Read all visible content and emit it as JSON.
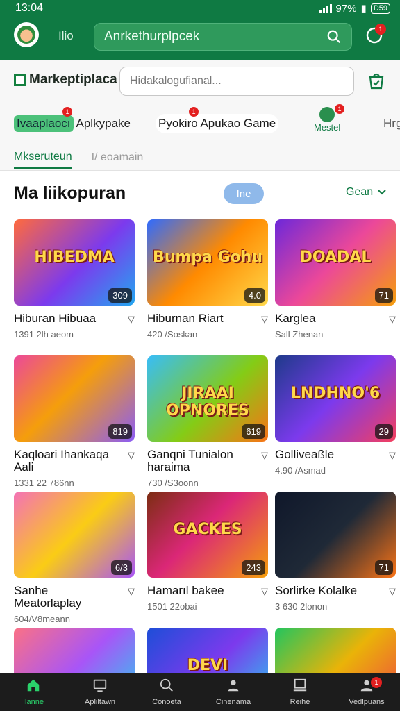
{
  "status": {
    "time": "13:04",
    "battery_pct": "97%",
    "battery_label": "D59"
  },
  "appbar": {
    "brand_small": "Ilio",
    "search_label": "Anrkethurplpcek",
    "notify_count": "1"
  },
  "site": {
    "logo_text": "Markeptiplaca",
    "search_placeholder": "Hidakalogufianal...",
    "chips": [
      {
        "highlight": "Ivaaplaocı",
        "label": "Aplkypake",
        "badge": "1"
      },
      {
        "label": "Pyokiro Apukao Game",
        "badge": "1"
      },
      {
        "label": "Mestel",
        "badge": "1"
      },
      {
        "label": "Hrg"
      }
    ],
    "subtabs": {
      "active": "Mkseruteun",
      "inactive": "I/ eoamain"
    }
  },
  "section": {
    "title": "Ma liikopuran",
    "pill": "Ine",
    "see_all": "Gean"
  },
  "cards": [
    {
      "title": "Hiburan Hibuaa",
      "meta": "1391 2lh aeom",
      "rating": "309",
      "tag": "HIBEDMA"
    },
    {
      "title": "Hiburnan Riart",
      "meta": "420 /Soskan",
      "rating": "4.0",
      "tag": "Bumpa Gohu"
    },
    {
      "title": "Karglea",
      "meta": "Sall Zhenan",
      "rating": "71",
      "tag": "DOADAL"
    },
    {
      "title": "Kaqloari Ihankaqa Aali",
      "meta": "1331 22 786nn",
      "rating": "819",
      "tag": ""
    },
    {
      "title": "Ganqni Tunialon haraima",
      "meta": "730 /S3oonn",
      "rating": "619",
      "tag": "JIRAAI OPNORES"
    },
    {
      "title": "Golliveaßle",
      "meta": "4.90 /Asmad",
      "rating": "29",
      "tag": "LNDHNO'6"
    },
    {
      "title": "Sanhe Meatorlaplay",
      "meta": "604/V8meann",
      "rating": "6/3",
      "tag": ""
    },
    {
      "title": "Hamarıl bakee",
      "meta": "1501 22obai",
      "rating": "243",
      "tag": "GACKES"
    },
    {
      "title": "Sorlirke Kolalke",
      "meta": "3 630 2lonon",
      "rating": "71",
      "tag": ""
    },
    {
      "title": "",
      "meta": "",
      "rating": "",
      "tag": ""
    },
    {
      "title": "",
      "meta": "",
      "rating": "",
      "tag": "DEVI ESKOLON"
    },
    {
      "title": "",
      "meta": "",
      "rating": "",
      "tag": ""
    }
  ],
  "nav": [
    {
      "label": "Ilanne",
      "icon": "home-icon"
    },
    {
      "label": "Apliltawn",
      "icon": "tv-icon"
    },
    {
      "label": "Conoeta",
      "icon": "search-icon"
    },
    {
      "label": "Cinenama",
      "icon": "people-icon"
    },
    {
      "label": "Reihe",
      "icon": "monitor-icon"
    },
    {
      "label": "Vedlpuans",
      "icon": "person-icon",
      "badge": "1"
    }
  ],
  "colors": {
    "brand": "#0f7a43",
    "accent": "#2ad26b",
    "nav_bg": "#1c1c1c"
  }
}
